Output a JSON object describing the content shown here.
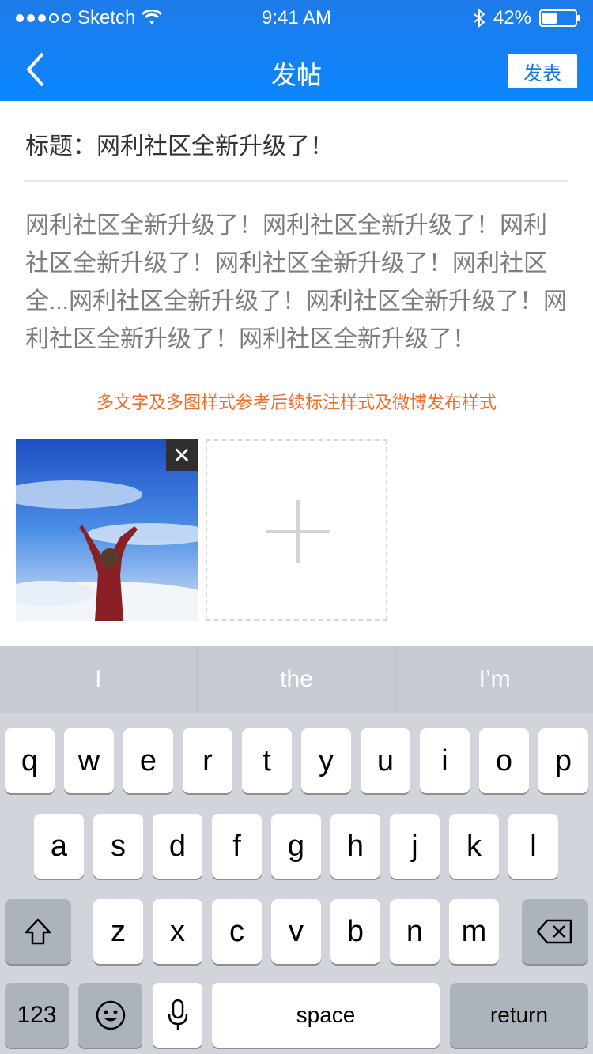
{
  "status": {
    "carrier": "Sketch",
    "time": "9:41 AM",
    "battery": "42%",
    "battery_fraction": 0.42
  },
  "nav": {
    "title": "发帖",
    "post_label": "发表"
  },
  "post": {
    "title_label": "标题：",
    "title_value": "网利社区全新升级了！",
    "body": "网利社区全新升级了！网利社区全新升级了！网利社区全新升级了！网利社区全新升级了！网利社区全...网利社区全新升级了！网利社区全新升级了！网利社区全新升级了！网利社区全新升级了！",
    "note": "多文字及多图样式参考后续标注样式及微博发布样式"
  },
  "keyboard": {
    "suggestions": [
      "I",
      "the",
      "I’m"
    ],
    "row1": [
      "q",
      "w",
      "e",
      "r",
      "t",
      "y",
      "u",
      "i",
      "o",
      "p"
    ],
    "row2": [
      "a",
      "s",
      "d",
      "f",
      "g",
      "h",
      "j",
      "k",
      "l"
    ],
    "row3": [
      "z",
      "x",
      "c",
      "v",
      "b",
      "n",
      "m"
    ],
    "numbers_label": "123",
    "space_label": "space",
    "return_label": "return"
  },
  "colors": {
    "nav_blue": "#1478ee",
    "note_orange": "#f06e2a"
  },
  "icons": [
    "back-chevron-icon",
    "wifi-icon",
    "bluetooth-icon",
    "battery-icon",
    "close-icon",
    "plus-icon",
    "shift-icon",
    "delete-icon",
    "emoji-icon",
    "microphone-icon"
  ]
}
